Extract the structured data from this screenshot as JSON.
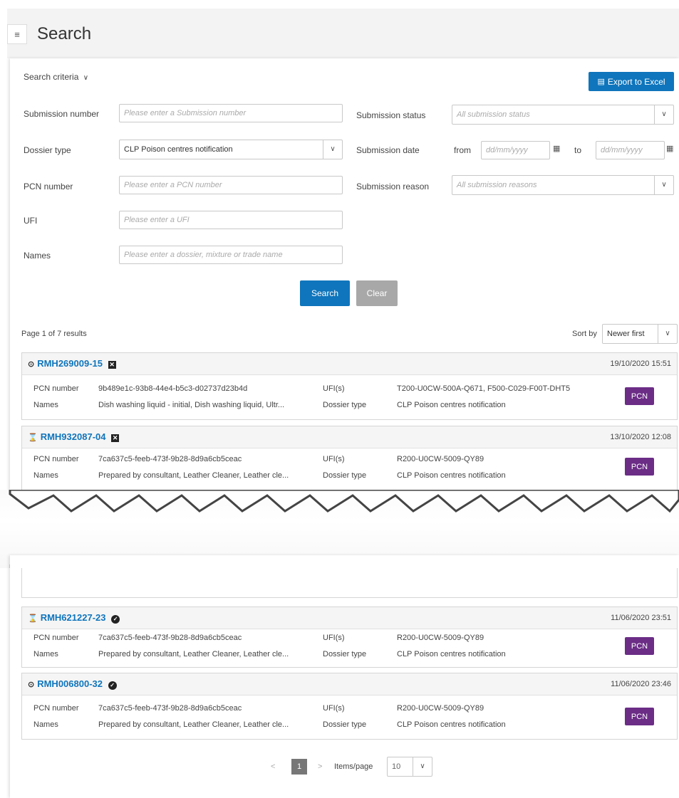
{
  "header": {
    "title": "Search",
    "menu_icon": "menu-icon"
  },
  "criteria": {
    "toggle_label": "Search criteria",
    "export_label": "Export to Excel",
    "submission_number": {
      "label": "Submission number",
      "placeholder": "Please enter a Submission number"
    },
    "dossier_type": {
      "label": "Dossier type",
      "value": "CLP Poison centres notification"
    },
    "pcn_number": {
      "label": "PCN number",
      "placeholder": "Please enter a PCN number"
    },
    "ufi": {
      "label": "UFI",
      "placeholder": "Please enter a UFI"
    },
    "names": {
      "label": "Names",
      "placeholder": "Please enter a dossier, mixture or trade name"
    },
    "submission_status": {
      "label": "Submission status",
      "placeholder": "All submission status"
    },
    "submission_date": {
      "label": "Submission date",
      "from_label": "from",
      "to_label": "to",
      "from_placeholder": "dd/mm/yyyy",
      "to_placeholder": "dd/mm/yyyy"
    },
    "submission_reason": {
      "label": "Submission reason",
      "placeholder": "All submission reasons"
    },
    "search_label": "Search",
    "clear_label": "Clear"
  },
  "results": {
    "summary": "Page 1 of 7 results",
    "sort_label": "Sort by",
    "sort_value": "Newer first",
    "field_labels": {
      "pcn": "PCN number",
      "names": "Names",
      "ufis": "UFI(s)",
      "dossier": "Dossier type"
    },
    "items": [
      {
        "id": "RMH269009-15",
        "state_icon": "circle-icon",
        "status_icon": "failed-icon",
        "date": "19/10/2020 15:51",
        "pcn": "9b489e1c-93b8-44e4-b5c3-d02737d23b4d",
        "names": "Dish washing liquid - initial, Dish washing liquid, Ultr...",
        "ufis": "T200-U0CW-500A-Q671, F500-C029-F00T-DHT5",
        "dossier": "CLP Poison centres notification",
        "badge": "PCN"
      },
      {
        "id": "RMH932087-04",
        "state_icon": "hourglass-icon",
        "status_icon": "failed-icon",
        "date": "13/10/2020 12:08",
        "pcn": "7ca637c5-feeb-473f-9b28-8d9a6cb5ceac",
        "names": "Prepared by consultant, Leather Cleaner, Leather cle...",
        "ufis": "R200-U0CW-5009-QY89",
        "dossier": "CLP Poison centres notification",
        "badge": "PCN"
      },
      {
        "id": "RMH621227-23",
        "state_icon": "hourglass-icon",
        "status_icon": "check-icon",
        "date": "11/06/2020 23:51",
        "pcn": "7ca637c5-feeb-473f-9b28-8d9a6cb5ceac",
        "names": "Prepared by consultant, Leather Cleaner, Leather cle...",
        "ufis": "R200-U0CW-5009-QY89",
        "dossier": "CLP Poison centres notification",
        "badge": "PCN"
      },
      {
        "id": "RMH006800-32",
        "state_icon": "circle-icon",
        "status_icon": "check-icon",
        "date": "11/06/2020 23:46",
        "pcn": "7ca637c5-feeb-473f-9b28-8d9a6cb5ceac",
        "names": "Prepared by consultant, Leather Cleaner, Leather cle...",
        "ufis": "R200-U0CW-5009-QY89",
        "dossier": "CLP Poison centres notification",
        "badge": "PCN"
      }
    ]
  },
  "pager": {
    "prev": "<",
    "current": "1",
    "next": ">",
    "items_label": "Items/page",
    "items_value": "10"
  },
  "colors": {
    "accent": "#0f75bc",
    "badge": "#6b2d86",
    "clear": "#a8a8a8"
  }
}
